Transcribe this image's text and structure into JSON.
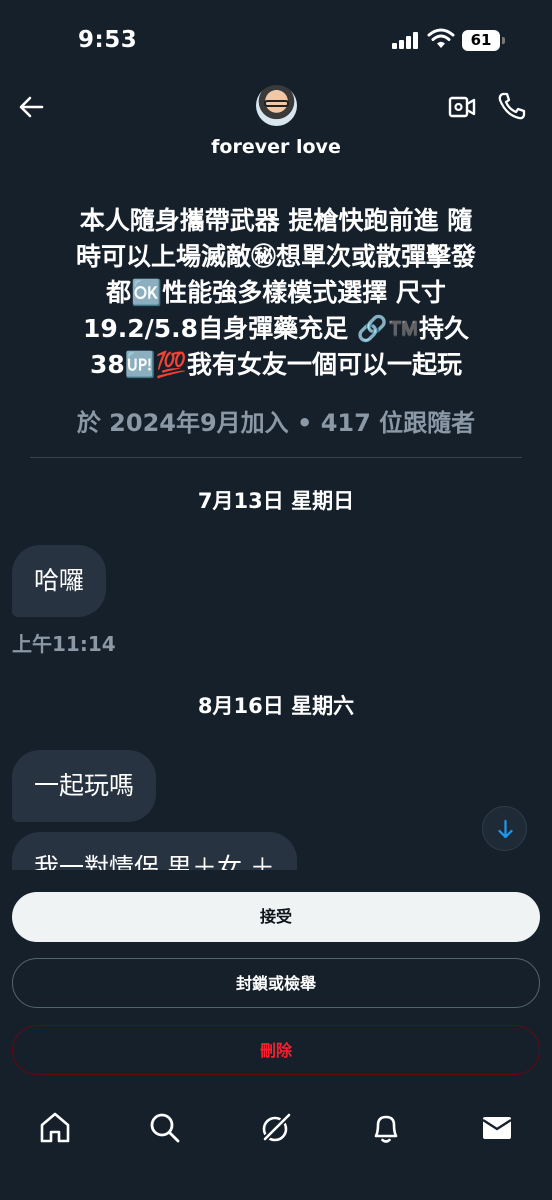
{
  "status_bar": {
    "time": "9:53",
    "battery": "61"
  },
  "header": {
    "contact_name": "forever love"
  },
  "profile": {
    "bio_lines": [
      "本人隨身攜帶武器 提槍快跑前進 隨",
      "時可以上場滅敵㊙想單次或散彈擊發",
      "都🆗性能強多樣模式選擇 尺寸",
      "19.2/5.8自身彈藥充足 🔗™️持久",
      "38🆙💯我有女友一個可以一起玩"
    ],
    "join_info": "於 2024年9月加入 • 417 位跟隨者"
  },
  "messages": [
    {
      "date": "7月13日 星期日",
      "text": "哈囉",
      "time": "上午11:14"
    },
    {
      "date": "8月16日 星期六",
      "text": "一起玩嗎",
      "time": ""
    },
    {
      "date": "",
      "text": "我一對情侶 男＋女 ＋",
      "time": ""
    }
  ],
  "actions": {
    "accept": "接受",
    "block_report": "封鎖或檢舉",
    "delete": "刪除"
  },
  "colors": {
    "background": "#15202b",
    "bubble": "#273340",
    "secondary_text": "#8b98a5",
    "danger": "#f4212e",
    "accent": "#1d9bf0"
  },
  "tab_bar": {
    "icons": [
      "home-icon",
      "search-icon",
      "grok-icon",
      "bell-icon",
      "mail-icon"
    ],
    "active": "mail-icon"
  }
}
